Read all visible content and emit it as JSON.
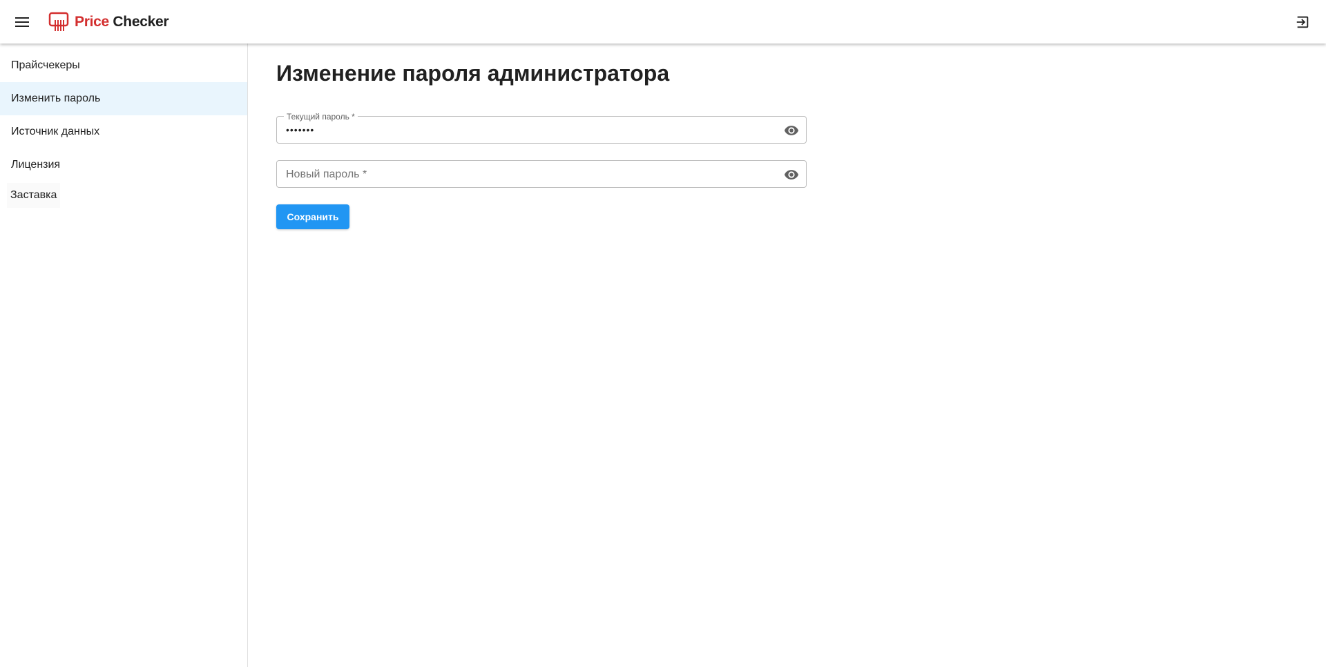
{
  "appbar": {
    "logo_text_part1": "Price",
    "logo_text_part2": "Checker",
    "menu_icon": "hamburger-menu-icon",
    "logout_icon": "logout-icon",
    "brand_color": "#d32f2f"
  },
  "sidebar": {
    "items": [
      {
        "label": "Прайсчекеры"
      },
      {
        "label": "Изменить пароль",
        "active": true
      },
      {
        "label": "Источник данных"
      },
      {
        "label": "Лицензия"
      },
      {
        "label": "Заставка"
      }
    ],
    "active_bg": "#e9f5fd"
  },
  "main": {
    "title": "Изменение пароля администратора",
    "current_password": {
      "label": "Текущий пароль *",
      "value": "•••••••",
      "icon": "eye-icon"
    },
    "new_password": {
      "placeholder": "Новый пароль *",
      "value": "",
      "icon": "eye-icon"
    },
    "save_label": "Сохранить",
    "accent_color": "#2196f3"
  }
}
